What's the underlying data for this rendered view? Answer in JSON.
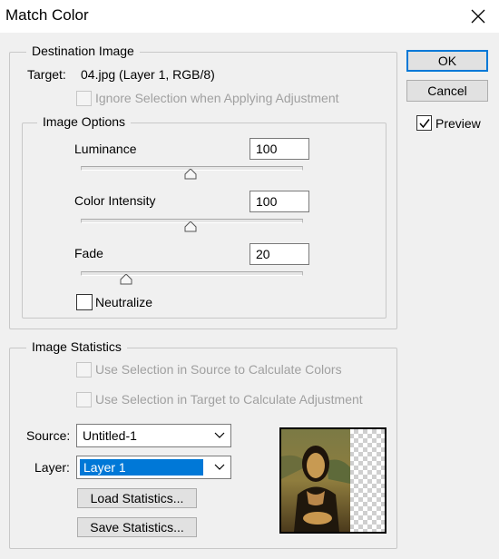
{
  "window": {
    "title": "Match Color",
    "close_icon": "close-icon"
  },
  "destination": {
    "legend": "Destination Image",
    "target_label": "Target:",
    "target_value": "04.jpg (Layer 1, RGB/8)",
    "ignore_selection_label": "Ignore Selection when Applying Adjustment",
    "ignore_selection_checked": false,
    "ignore_selection_disabled": true
  },
  "image_options": {
    "legend": "Image Options",
    "luminance": {
      "label": "Luminance",
      "value": "100",
      "slider_fraction": 0.5
    },
    "color_intensity": {
      "label": "Color Intensity",
      "value": "100",
      "slider_fraction": 0.5
    },
    "fade": {
      "label": "Fade",
      "value": "20",
      "slider_fraction": 0.2
    },
    "neutralize": {
      "label": "Neutralize",
      "checked": false
    }
  },
  "buttons": {
    "ok": "OK",
    "cancel": "Cancel"
  },
  "preview": {
    "label": "Preview",
    "checked": true
  },
  "statistics": {
    "legend": "Image Statistics",
    "use_source_label": "Use Selection in Source to Calculate Colors",
    "use_target_label": "Use Selection in Target to Calculate Adjustment",
    "source_label": "Source:",
    "source_value": "Untitled-1",
    "layer_label": "Layer:",
    "layer_value": "Layer 1",
    "load_button": "Load Statistics...",
    "save_button": "Save Statistics..."
  },
  "colors": {
    "accent": "#0078d7",
    "disabled_text": "#a0a0a0"
  }
}
